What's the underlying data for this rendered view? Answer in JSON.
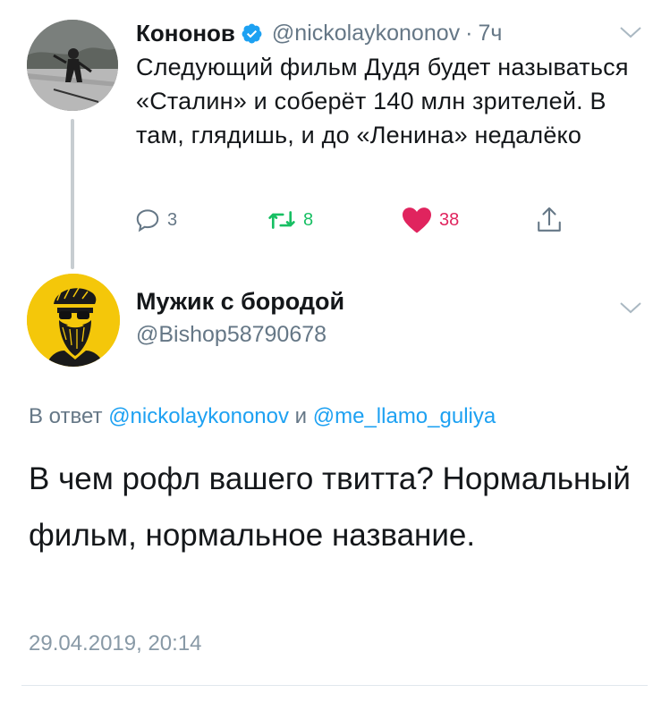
{
  "parent_tweet": {
    "author_name": "Кононов",
    "handle": "@nickolaykononov",
    "separator": "·",
    "time": "7ч",
    "text": "Следующий фильм Дудя будет называться «Сталин» и соберёт 140 млн зрителей. В там, глядишь, и до «Ленина» недалёко",
    "verified": true,
    "actions": {
      "reply_count": "3",
      "retweet_count": "8",
      "like_count": "38"
    }
  },
  "reply_tweet": {
    "author_name": "Мужик с бородой",
    "handle": "@Bishop58790678",
    "reply_prefix": "В ответ",
    "reply_to_1": "@nickolaykononov",
    "reply_conjunction": "и",
    "reply_to_2": "@me_llamo_guliya",
    "text": "В чем рофл вашего твитта? Нормальный фильм, нормальное название.",
    "timestamp": "29.04.2019, 20:14"
  },
  "colors": {
    "text": "#14171a",
    "secondary": "#657786",
    "link": "#1da1f2",
    "retweet": "#17bf63",
    "like": "#e0245e",
    "avatar_bg": "#f4c70a"
  },
  "icons": {
    "verified": "verified-badge-icon",
    "menu": "chevron-down-icon",
    "reply": "reply-icon",
    "retweet": "retweet-icon",
    "like": "heart-icon",
    "share": "share-icon"
  }
}
